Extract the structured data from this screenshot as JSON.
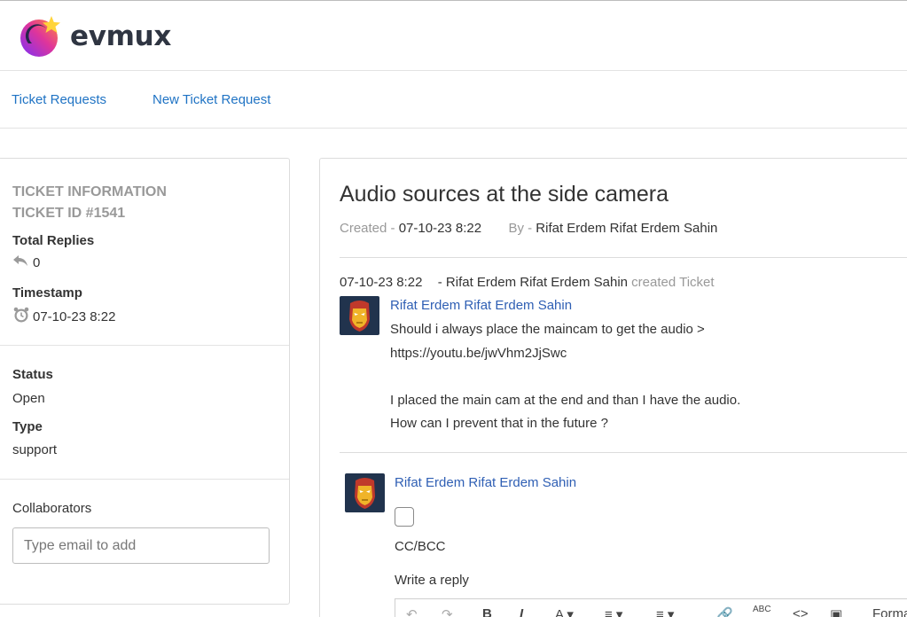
{
  "app": {
    "logo_text": "evmux"
  },
  "nav": {
    "items": [
      {
        "label": "Ticket Requests"
      },
      {
        "label": "New Ticket Request"
      }
    ]
  },
  "sidebar": {
    "heading_line1": "TICKET INFORMATION",
    "heading_line2": "TICKET ID #1541",
    "total_replies_label": "Total Replies",
    "total_replies_value": "0",
    "timestamp_label": "Timestamp",
    "timestamp_value": "07-10-23 8:22",
    "status_label": "Status",
    "status_value": "Open",
    "type_label": "Type",
    "type_value": "support",
    "collaborators_label": "Collaborators",
    "collaborators_placeholder": "Type email to add"
  },
  "ticket": {
    "title": "Audio sources at the side camera",
    "created_label": "Created - ",
    "created_value": "07-10-23 8:22",
    "by_label": "By - ",
    "by_value": "Rifat Erdem Rifat Erdem Sahin"
  },
  "thread": {
    "timestamp": "07-10-23 8:22",
    "actor_prefix": "- Rifat Erdem Rifat Erdem Sahin",
    "action": "created Ticket",
    "author": "Rifat Erdem Rifat Erdem Sahin",
    "message": "Should i always place the maincam to get the audio >\nhttps://youtu.be/jwVhm2JjSwc\n\nI placed the main cam at the end and than I have the audio.\nHow can I prevent that in the future ?"
  },
  "reply": {
    "author": "Rifat Erdem Rifat Erdem Sahin",
    "cc_label": "CC/BCC",
    "write_label": "Write a reply",
    "toolbar_format_label": "Forma"
  },
  "colors": {
    "link": "#1f73c4",
    "author_link": "#2f5fb4",
    "avatar_bg": "#21334d",
    "muted": "#999999"
  }
}
